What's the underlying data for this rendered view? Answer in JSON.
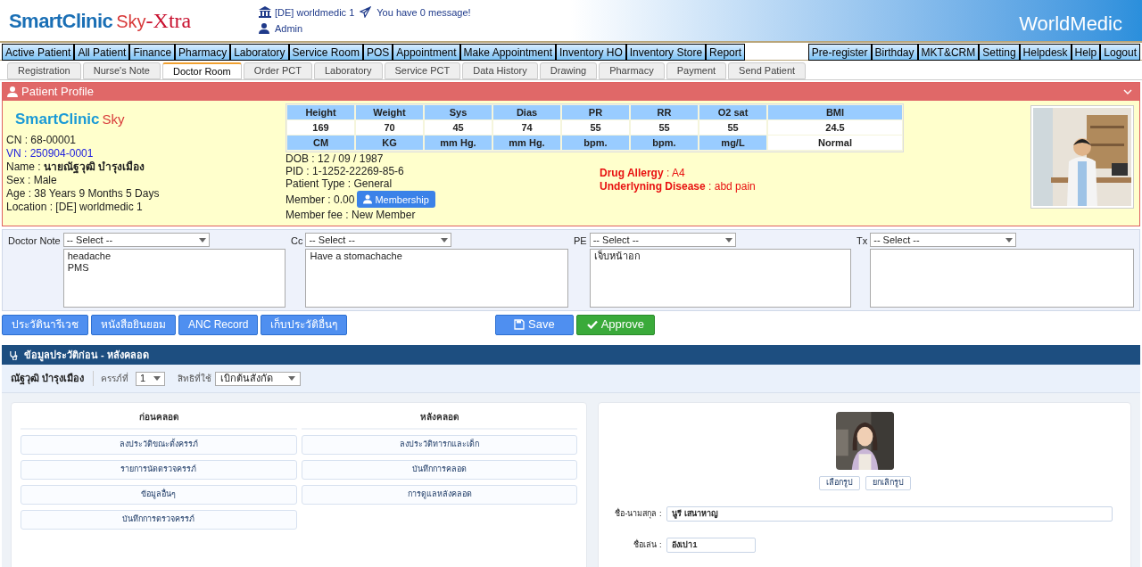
{
  "header": {
    "logo": {
      "brand": "SmartClinic",
      "sub": "Sky",
      "suffix": "-Xtra"
    },
    "clinic": "[DE] worldmedic 1",
    "message": "You have 0 message!",
    "user": "Admin",
    "right_logo": "WorldMedic"
  },
  "main_menu": {
    "left": [
      "Active Patient",
      "All Patient",
      "Finance",
      "Pharmacy",
      "Laboratory",
      "Service Room",
      "POS",
      "Appointment",
      "Make Appointment",
      "Inventory HO",
      "Inventory Store",
      "Report"
    ],
    "right": [
      "Pre-register",
      "Birthday",
      "MKT&CRM",
      "Setting",
      "Helpdesk",
      "Help",
      "Logout"
    ]
  },
  "tabs": [
    {
      "label": "Registration",
      "selected": false
    },
    {
      "label": "Nurse's Note",
      "selected": false
    },
    {
      "label": "Doctor Room",
      "selected": true
    },
    {
      "label": "Order PCT",
      "selected": false
    },
    {
      "label": "Laboratory",
      "selected": false
    },
    {
      "label": "Service PCT",
      "selected": false
    },
    {
      "label": "Data History",
      "selected": false
    },
    {
      "label": "Drawing",
      "selected": false
    },
    {
      "label": "Pharmacy",
      "selected": false
    },
    {
      "label": "Payment",
      "selected": false
    },
    {
      "label": "Send Patient",
      "selected": false
    }
  ],
  "profile": {
    "title": "Patient Profile",
    "logo": {
      "brand": "SmartClinic",
      "sub": "Sky"
    },
    "fields": [
      {
        "text": "CN : 68-00001",
        "kind": "plain"
      },
      {
        "text": "VN : 250904-0001",
        "kind": "accent"
      },
      {
        "label": "Name : ",
        "value": "นายณัฐวุฒิ บำรุงเมือง",
        "kind": "bold"
      },
      {
        "text": "Sex : Male",
        "kind": "plain"
      },
      {
        "text": "Age : 38 Years 9 Months 5 Days",
        "kind": "plain"
      },
      {
        "text": "Location : [DE] worldmedic 1",
        "kind": "plain"
      }
    ],
    "vitals": [
      {
        "name": "Height",
        "value": "169",
        "unit": "CM",
        "kind": "unit"
      },
      {
        "name": "Weight",
        "value": "70",
        "unit": "KG",
        "kind": "unit"
      },
      {
        "name": "Sys",
        "value": "45",
        "unit": "mm Hg.",
        "kind": "unit"
      },
      {
        "name": "Dias",
        "value": "74",
        "unit": "mm Hg.",
        "kind": "unit"
      },
      {
        "name": "PR",
        "value": "55",
        "unit": "bpm.",
        "kind": "unit"
      },
      {
        "name": "RR",
        "value": "55",
        "unit": "bpm.",
        "kind": "unit"
      },
      {
        "name": "O2 sat",
        "value": "55",
        "unit": "mg/L",
        "kind": "unit"
      },
      {
        "name": "BMI",
        "value": "24.5",
        "unit": "Normal",
        "kind": "status"
      }
    ],
    "dob": "DOB : 12 / 09 / 1987",
    "pid": "PID : 1-1252-22269-85-6",
    "patient_type": "Patient Type : General",
    "member": "Member : 0.00",
    "membership_button": "Membership",
    "member_fee": "Member fee : New Member",
    "alerts": [
      {
        "label": "Drug Allergy",
        "value": " : A4"
      },
      {
        "label": "Underlyning Disease",
        "value": " : abd pain"
      }
    ]
  },
  "notes": [
    {
      "label": "Doctor Note",
      "select": "-- Select --",
      "text": "headache\nPMS"
    },
    {
      "label": "Cc",
      "select": "-- Select --",
      "text": "Have a stomachache"
    },
    {
      "label": "PE",
      "select": "-- Select --",
      "text": "เจ็บหน้าอก"
    },
    {
      "label": "Tx",
      "select": "-- Select --"
    }
  ],
  "actions": {
    "left": [
      "ประวัตินารีเวช",
      "หนังสือยินยอม",
      "ANC Record",
      "เก็บประวัติอื่นๆ"
    ],
    "save": "Save",
    "approve": "Approve"
  },
  "section": {
    "title": "ข้อมูลประวัติก่อน - หลังคลอด",
    "patient_name": "ณัฐวุฒิ บำรุงเมือง",
    "pregnancy_label": "ครรภ์ที่",
    "pregnancy_value": "1",
    "right_label": "สิทธิที่ใช้",
    "right_value": "เบิกต้นสังกัด",
    "columns": [
      {
        "title": "ก่อนคลอด",
        "items": [
          "ลงประวัติขณะตั้งครรภ์",
          "รายการนัดตรวจครรภ์",
          "ข้อมูลอื่นๆ",
          "บันทึกการตรวจครรภ์"
        ]
      },
      {
        "title": "หลังคลอด",
        "items": [
          "ลงประวัติทารกและเด็ก",
          "บันทึกการคลอด",
          "การดูแลหลังคลอด"
        ]
      }
    ],
    "photo_buttons": [
      "เลือกรูป",
      "ยกเลิกรูป"
    ],
    "fields": [
      {
        "label": "ชื่อ-นามสกุล :",
        "value": "นูรี เสนาหาญ",
        "kind": "wide"
      },
      {
        "label": "ชื่อเล่น :",
        "value": "อังเปา1",
        "kind": "short"
      }
    ]
  }
}
